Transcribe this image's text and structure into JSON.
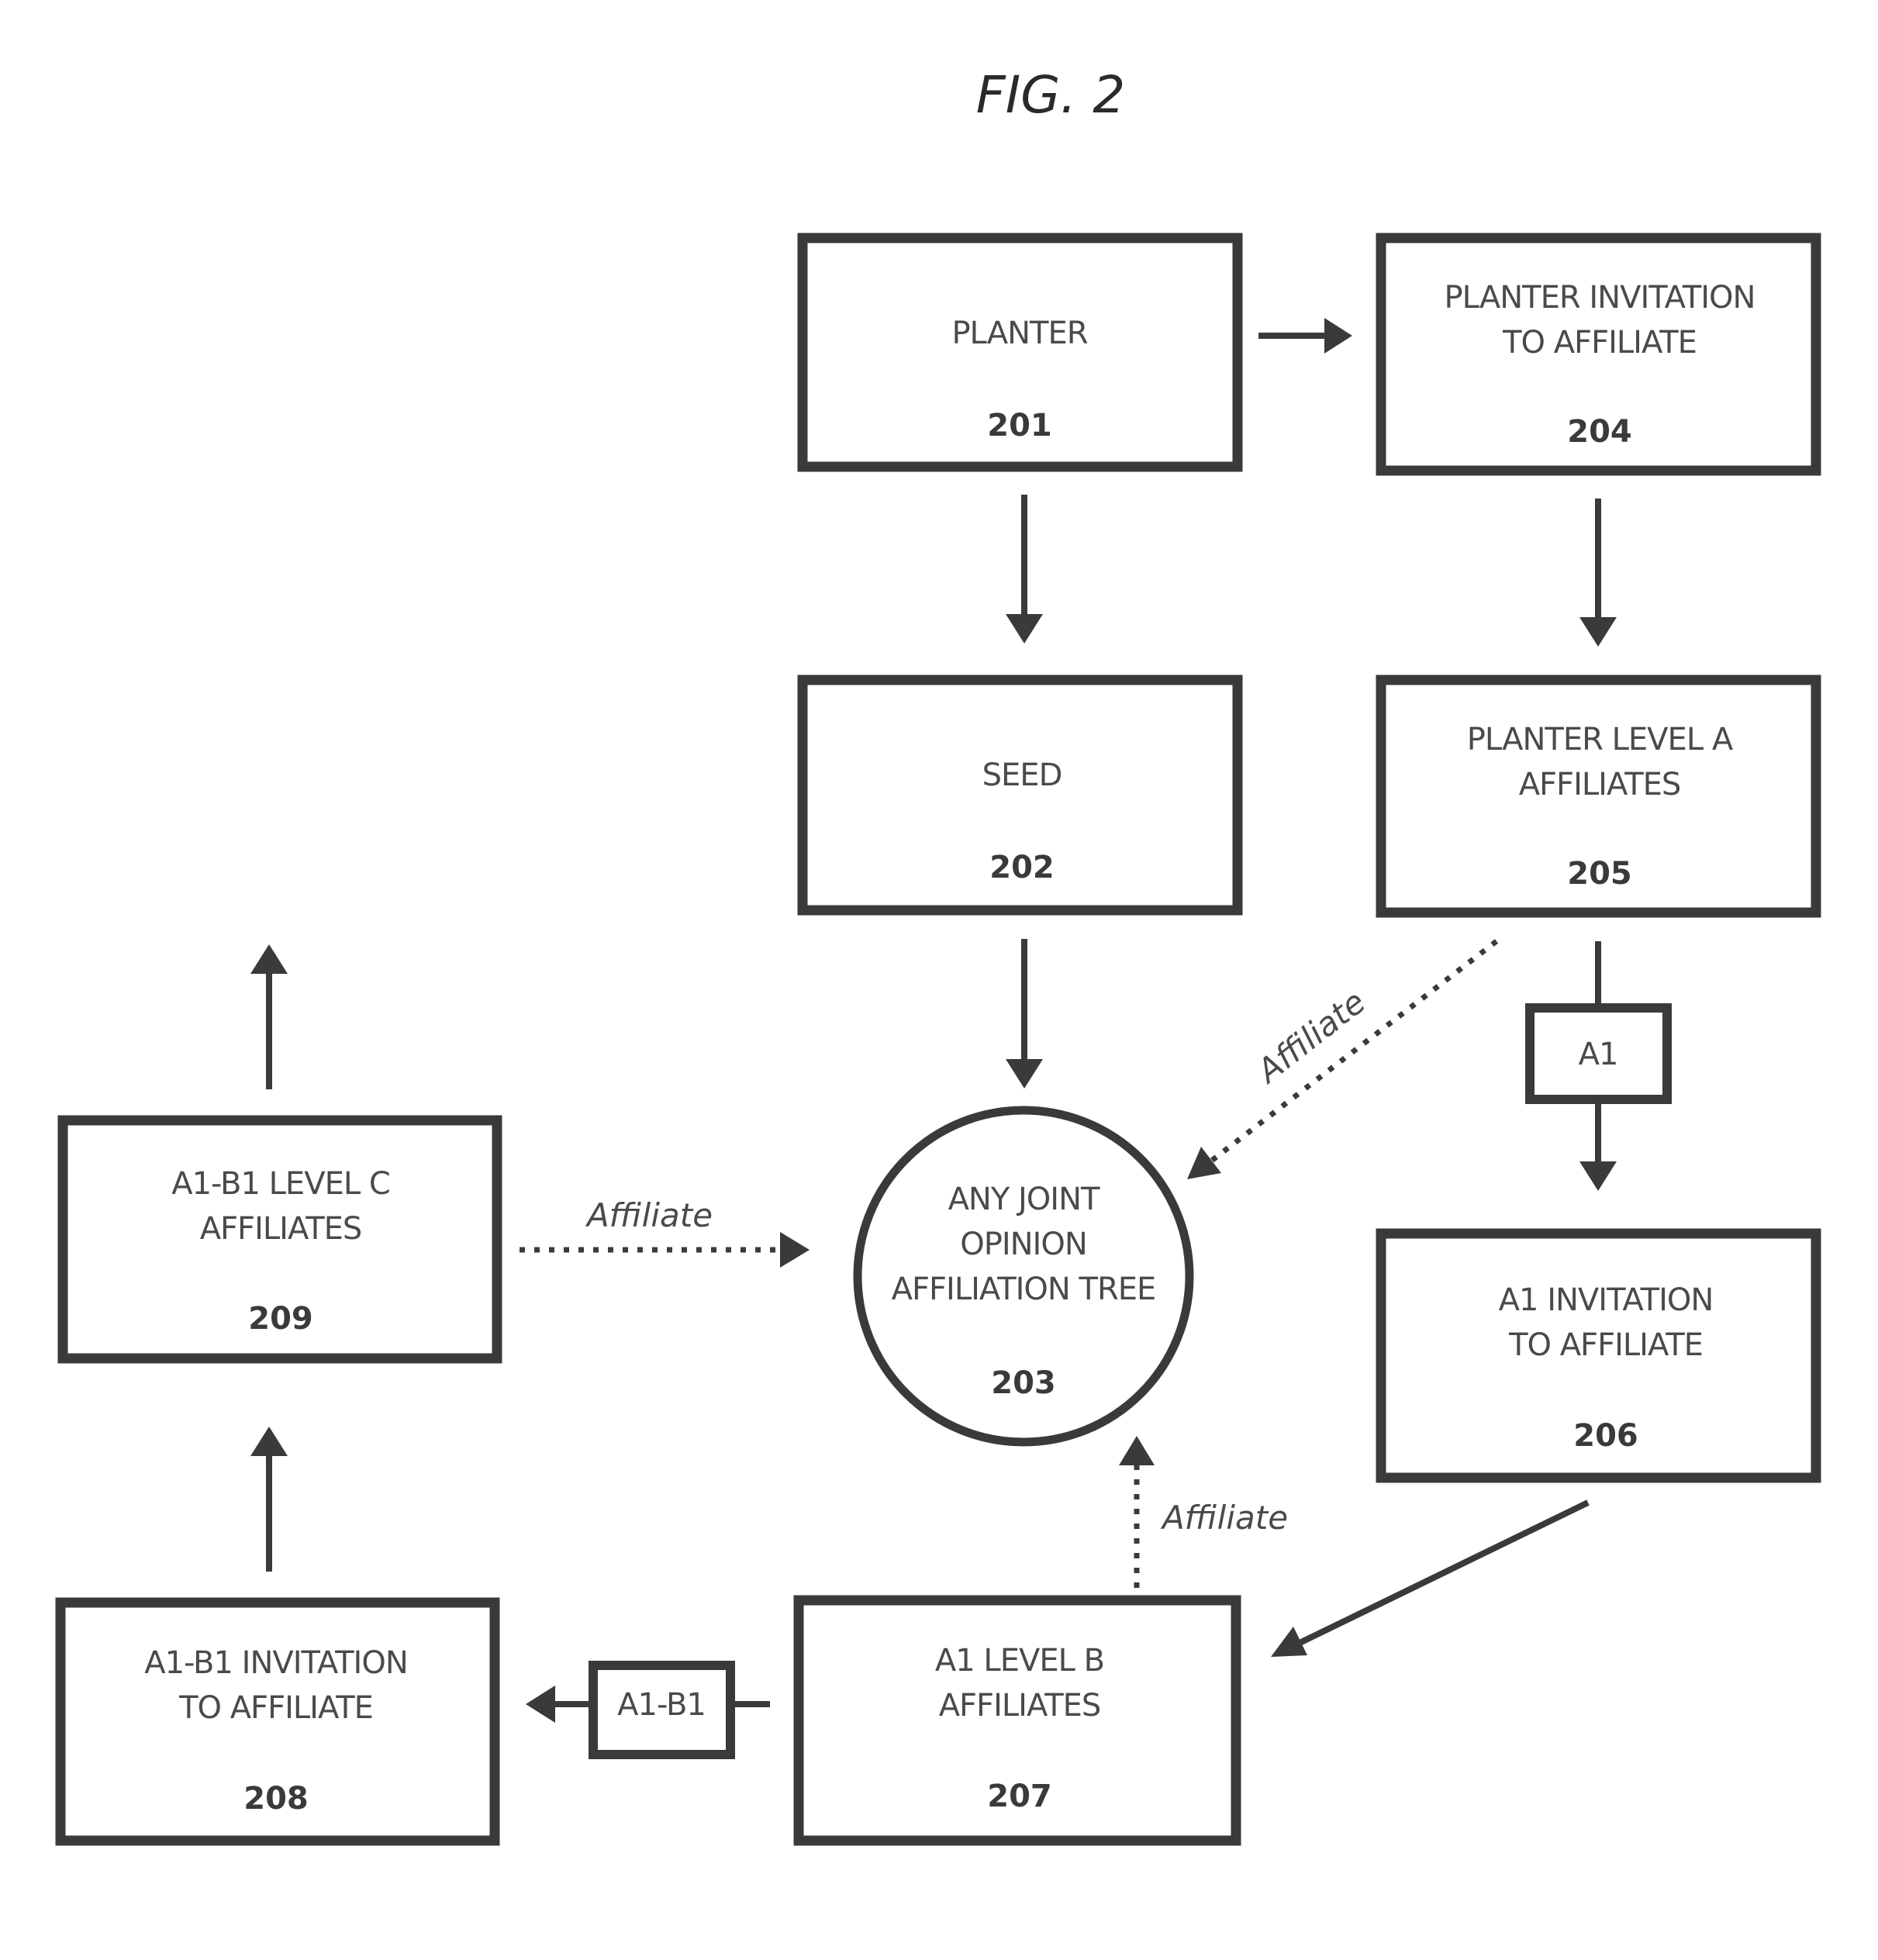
{
  "figure": {
    "title": "FIG. 2"
  },
  "nodes": {
    "n201": {
      "lines": [
        "PLANTER"
      ],
      "number": "201"
    },
    "n202": {
      "lines": [
        "SEED"
      ],
      "number": "202"
    },
    "n203": {
      "lines": [
        "ANY JOINT",
        "OPINION",
        "AFFILIATION TREE"
      ],
      "number": "203"
    },
    "n204": {
      "lines": [
        "PLANTER INVITATION",
        "TO AFFILIATE"
      ],
      "number": "204"
    },
    "n205": {
      "lines": [
        "PLANTER LEVEL A",
        "AFFILIATES"
      ],
      "number": "205"
    },
    "n206": {
      "lines": [
        "A1 INVITATION",
        "TO AFFILIATE"
      ],
      "number": "206"
    },
    "n207": {
      "lines": [
        "A1 LEVEL B",
        "AFFILIATES"
      ],
      "number": "207"
    },
    "n208": {
      "lines": [
        "A1-B1 INVITATION",
        "TO AFFILIATE"
      ],
      "number": "208"
    },
    "n209": {
      "lines": [
        "A1-B1 LEVEL C",
        "AFFILIATES"
      ],
      "number": "209"
    }
  },
  "connector_labels": {
    "a1": "A1",
    "a1b1": "A1-B1"
  },
  "edge_labels": {
    "from_205": "Affiliate",
    "from_207": "Affiliate",
    "from_209": "Affiliate"
  },
  "edges": [
    {
      "from": "201",
      "to": "204",
      "style": "solid"
    },
    {
      "from": "201",
      "to": "202",
      "style": "solid"
    },
    {
      "from": "204",
      "to": "205",
      "style": "solid"
    },
    {
      "from": "202",
      "to": "203",
      "style": "solid"
    },
    {
      "from": "205",
      "to": "206",
      "style": "solid",
      "via": "A1"
    },
    {
      "from": "206",
      "to": "207",
      "style": "solid"
    },
    {
      "from": "207",
      "to": "208",
      "style": "solid",
      "via": "A1-B1"
    },
    {
      "from": "208",
      "to": "209",
      "style": "solid"
    },
    {
      "from": "209",
      "to": "next-level",
      "style": "solid"
    },
    {
      "from": "205",
      "to": "203",
      "style": "dotted",
      "label": "Affiliate"
    },
    {
      "from": "207",
      "to": "203",
      "style": "dotted",
      "label": "Affiliate"
    },
    {
      "from": "209",
      "to": "203",
      "style": "dotted",
      "label": "Affiliate"
    }
  ]
}
